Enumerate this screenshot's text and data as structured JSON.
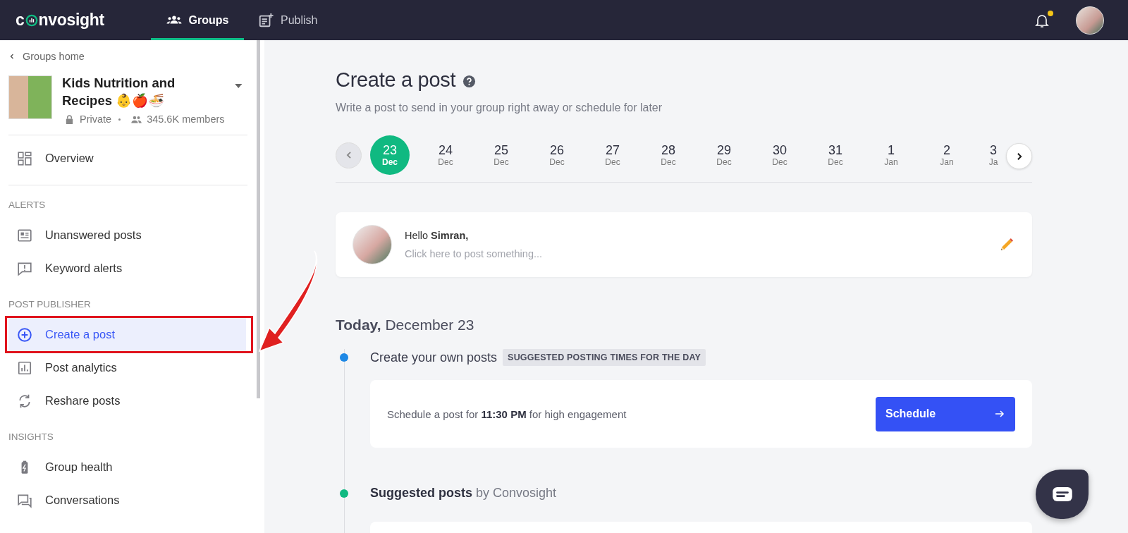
{
  "logo": {
    "before": "c",
    "after": "nvosight"
  },
  "nav": [
    {
      "label": "Groups",
      "selected": true
    },
    {
      "label": "Publish",
      "selected": false
    }
  ],
  "notifications": {
    "unread": true
  },
  "sidebar": {
    "back": "Groups home",
    "group": {
      "name": "Kids Nutrition and Recipes 👶🍎🍜",
      "privacy": "Private",
      "members": "345.6K members"
    },
    "top_items": [
      {
        "label": "Overview",
        "selected": false
      }
    ],
    "sections": [
      {
        "title": "ALERTS",
        "items": [
          {
            "label": "Unanswered posts",
            "selected": false
          },
          {
            "label": "Keyword alerts",
            "selected": false
          }
        ]
      },
      {
        "title": "POST PUBLISHER",
        "items": [
          {
            "label": "Create a post",
            "selected": true
          },
          {
            "label": "Post analytics",
            "selected": false
          },
          {
            "label": "Reshare posts",
            "selected": false
          }
        ]
      },
      {
        "title": "INSIGHTS",
        "items": [
          {
            "label": "Group health",
            "selected": false
          },
          {
            "label": "Conversations",
            "selected": false
          }
        ]
      }
    ]
  },
  "page": {
    "title": "Create a post",
    "subtitle": "Write a post to send in your group right away or schedule for later"
  },
  "dates": [
    {
      "day": "23",
      "month": "Dec",
      "selected": true
    },
    {
      "day": "24",
      "month": "Dec",
      "selected": false
    },
    {
      "day": "25",
      "month": "Dec",
      "selected": false
    },
    {
      "day": "26",
      "month": "Dec",
      "selected": false
    },
    {
      "day": "27",
      "month": "Dec",
      "selected": false
    },
    {
      "day": "28",
      "month": "Dec",
      "selected": false
    },
    {
      "day": "29",
      "month": "Dec",
      "selected": false
    },
    {
      "day": "30",
      "month": "Dec",
      "selected": false
    },
    {
      "day": "31",
      "month": "Dec",
      "selected": false
    },
    {
      "day": "1",
      "month": "Jan",
      "selected": false
    },
    {
      "day": "2",
      "month": "Jan",
      "selected": false
    },
    {
      "day": "3",
      "month": "Ja",
      "selected": false
    }
  ],
  "composer": {
    "greeting": "Hello **Simran,**",
    "placeholder": "Click here to post something..."
  },
  "today": {
    "text": "**Today,** December 23"
  },
  "timeline": [
    {
      "title": "Create your own posts",
      "tag": "SUGGESTED POSTING TIMES FOR THE DAY",
      "color": "#1e88e5",
      "card": {
        "text": "Schedule a post for **11:30 PM** for high engagement",
        "button": "Schedule"
      }
    },
    {
      "title": "**Suggested posts** by Convosight",
      "color": "#10b981"
    }
  ]
}
